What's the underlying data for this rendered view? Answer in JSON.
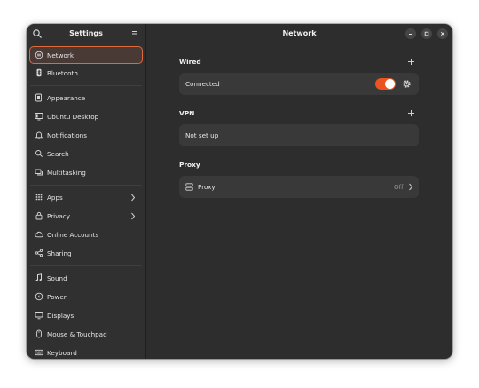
{
  "sidebar": {
    "title": "Settings",
    "items": [
      {
        "label": "Network"
      },
      {
        "label": "Bluetooth"
      },
      {
        "label": "Appearance"
      },
      {
        "label": "Ubuntu Desktop"
      },
      {
        "label": "Notifications"
      },
      {
        "label": "Search"
      },
      {
        "label": "Multitasking"
      },
      {
        "label": "Apps"
      },
      {
        "label": "Privacy"
      },
      {
        "label": "Online Accounts"
      },
      {
        "label": "Sharing"
      },
      {
        "label": "Sound"
      },
      {
        "label": "Power"
      },
      {
        "label": "Displays"
      },
      {
        "label": "Mouse & Touchpad"
      },
      {
        "label": "Keyboard"
      }
    ]
  },
  "main": {
    "title": "Network",
    "wired": {
      "title": "Wired",
      "status": "Connected",
      "toggle_on": true
    },
    "vpn": {
      "title": "VPN",
      "status": "Not set up"
    },
    "proxy": {
      "title": "Proxy",
      "label": "Proxy",
      "value": "Off"
    }
  },
  "colors": {
    "accent": "#e95420",
    "window_bg": "#2d2d2d",
    "row_bg": "#393939"
  },
  "icons": {
    "search": "search-icon",
    "menu": "hamburger-menu-icon",
    "minimize": "minimize-icon",
    "maximize": "maximize-icon",
    "close": "close-icon",
    "settings": "gear-icon",
    "add": "plus-icon"
  }
}
